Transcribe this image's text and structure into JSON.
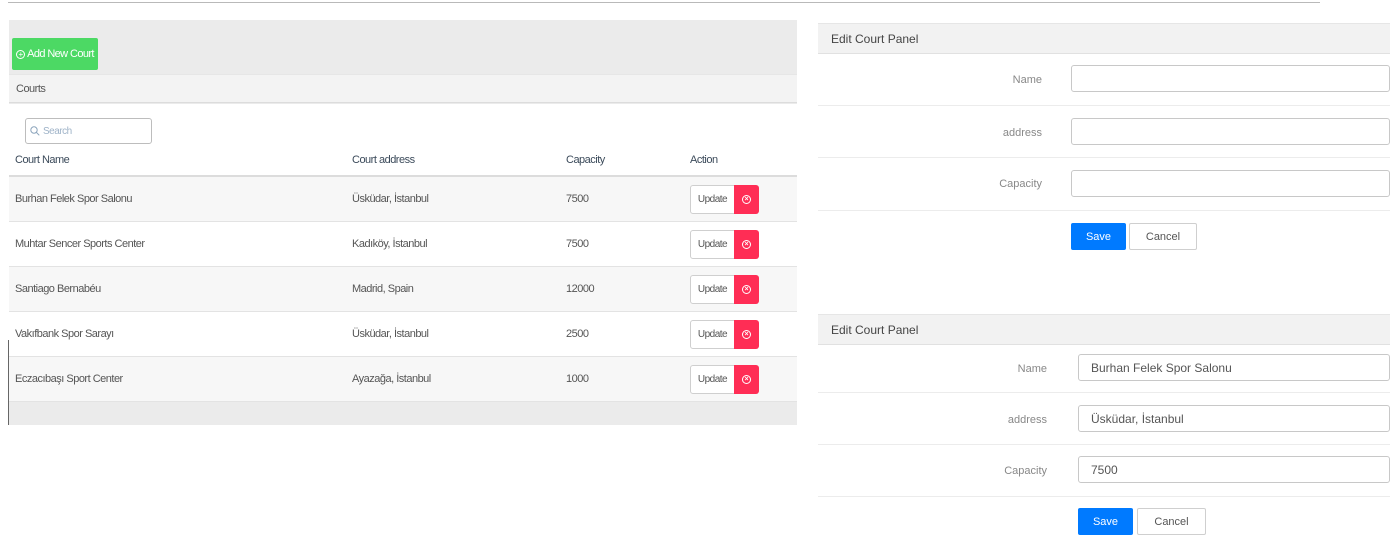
{
  "toolbar": {
    "add_label": "Add New Court"
  },
  "courts": {
    "title": "Courts",
    "search_placeholder": "Search",
    "columns": [
      "Court Name",
      "Court address",
      "Capacity",
      "Action"
    ],
    "rows": [
      {
        "name": "Burhan Felek Spor Salonu",
        "address": "Üsküdar, İstanbul",
        "capacity": "7500",
        "update_label": "Update"
      },
      {
        "name": "Muhtar Sencer Sports Center",
        "address": "Kadıköy, İstanbul",
        "capacity": "7500",
        "update_label": "Update"
      },
      {
        "name": "Santiago Bernabéu",
        "address": "Madrid, Spain",
        "capacity": "12000",
        "update_label": "Update"
      },
      {
        "name": "Vakıfbank Spor Sarayı",
        "address": "Üsküdar, İstanbul",
        "capacity": "2500",
        "update_label": "Update"
      },
      {
        "name": "Eczacıbaşı Sport Center",
        "address": "Ayazağa, İstanbul",
        "capacity": "1000",
        "update_label": "Update"
      }
    ]
  },
  "edit_panel_empty": {
    "title": "Edit Court Panel",
    "name_label": "Name",
    "address_label": "address",
    "capacity_label": "Capacity",
    "name_value": "",
    "address_value": "",
    "capacity_value": "",
    "save_label": "Save",
    "cancel_label": "Cancel"
  },
  "edit_panel_filled": {
    "title": "Edit Court Panel",
    "name_label": "Name",
    "address_label": "address",
    "capacity_label": "Capacity",
    "name_value": "Burhan Felek Spor Salonu",
    "address_value": "Üsküdar, İstanbul",
    "capacity_value": "7500",
    "save_label": "Save",
    "cancel_label": "Cancel"
  },
  "colors": {
    "add_button": "#4cd964",
    "delete_button": "#ff2d55",
    "save_button": "#007aff"
  },
  "icons": [
    "plus-circle-icon",
    "search-icon",
    "close-circle-icon"
  ]
}
